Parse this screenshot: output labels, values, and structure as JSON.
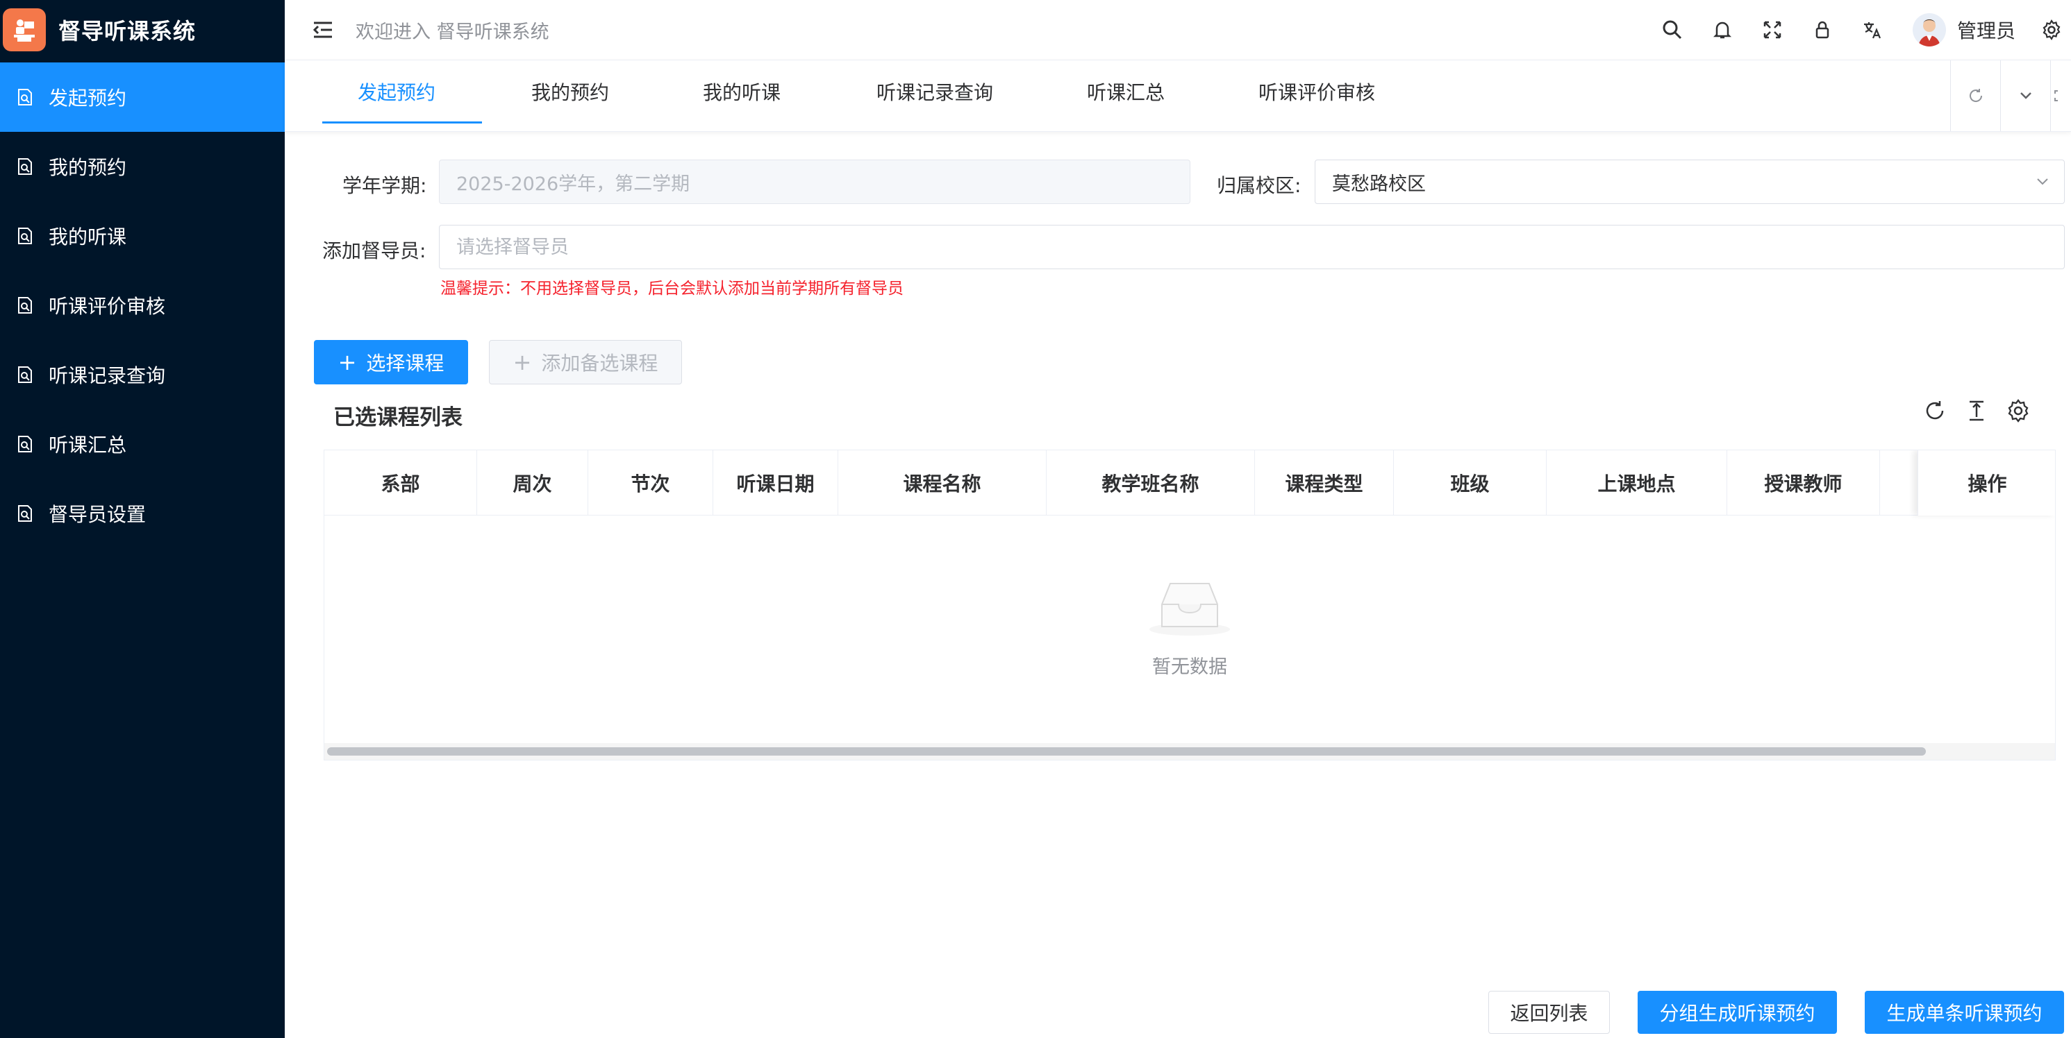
{
  "app": {
    "title": "督导听课系统"
  },
  "sidebar": {
    "items": [
      {
        "label": "发起预约",
        "active": true
      },
      {
        "label": "我的预约"
      },
      {
        "label": "我的听课"
      },
      {
        "label": "听课评价审核"
      },
      {
        "label": "听课记录查询"
      },
      {
        "label": "听课汇总"
      },
      {
        "label": "督导员设置"
      }
    ]
  },
  "header": {
    "welcome": "欢迎进入 督导听课系统",
    "user_name": "管理员"
  },
  "tabs": [
    {
      "label": "发起预约",
      "active": true
    },
    {
      "label": "我的预约"
    },
    {
      "label": "我的听课"
    },
    {
      "label": "听课记录查询"
    },
    {
      "label": "听课汇总"
    },
    {
      "label": "听课评价审核"
    }
  ],
  "form": {
    "term_label": "学年学期:",
    "term_value": "2025-2026学年，第二学期",
    "campus_label": "归属校区:",
    "campus_value": "莫愁路校区",
    "supervisor_label": "添加督导员:",
    "supervisor_placeholder": "请选择督导员",
    "tip": "温馨提示：不用选择督导员，后台会默认添加当前学期所有督导员"
  },
  "actions": {
    "select_course": "选择课程",
    "add_backup_course": "添加备选课程"
  },
  "table": {
    "title": "已选课程列表",
    "columns": [
      "系部",
      "周次",
      "节次",
      "听课日期",
      "课程名称",
      "教学班名称",
      "课程类型",
      "班级",
      "上课地点",
      "授课教师",
      "操作"
    ],
    "empty_text": "暂无数据"
  },
  "footer": {
    "back": "返回列表",
    "group_generate": "分组生成听课预约",
    "single_generate": "生成单条听课预约"
  },
  "colors": {
    "sidebar_bg": "#001529",
    "primary": "#1890ff",
    "tip": "#f5222d",
    "logo": "#f4784a"
  }
}
